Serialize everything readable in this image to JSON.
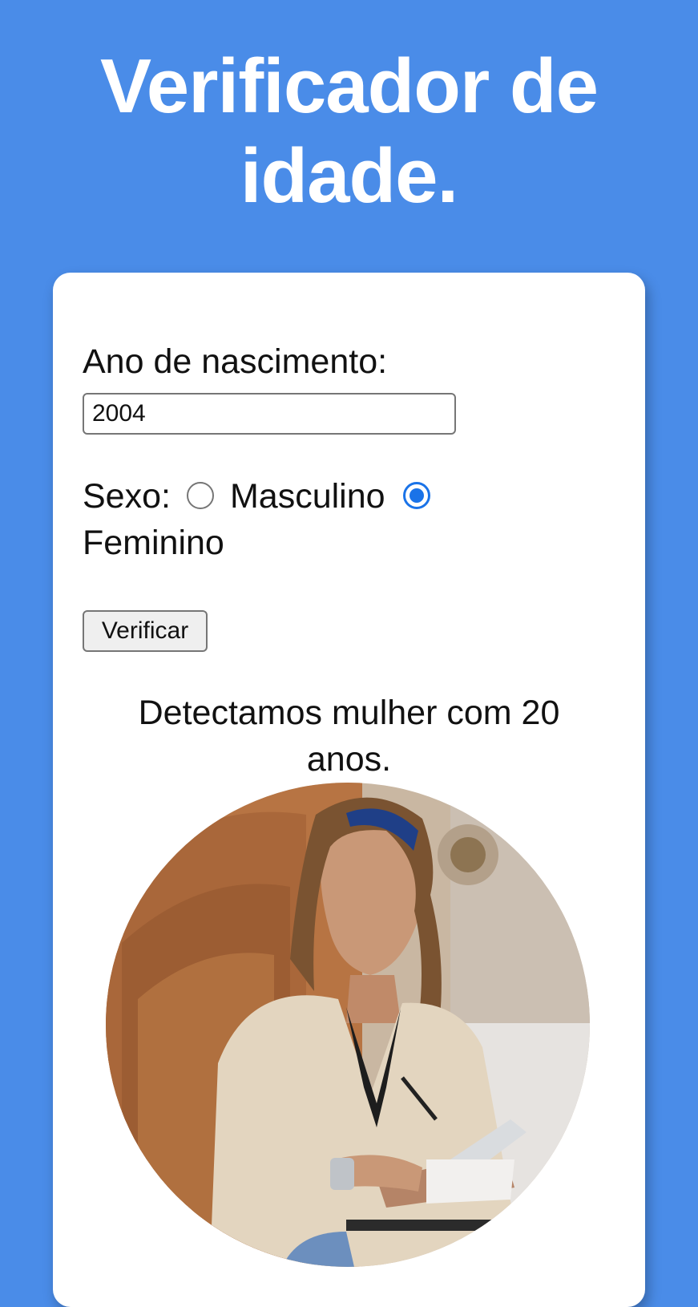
{
  "header": {
    "title": "Verificador de idade."
  },
  "form": {
    "year_label": "Ano de nascimento:",
    "year_value": "2004",
    "sex_label": "Sexo:",
    "options": [
      {
        "label": "Masculino",
        "checked": false
      },
      {
        "label": "Feminino",
        "checked": true
      }
    ],
    "button_label": "Verificar"
  },
  "result": {
    "text": "Detectamos mulher com 20 anos."
  },
  "colors": {
    "background": "#4a8ce8",
    "card": "#ffffff",
    "radio_accent": "#1a73e8"
  }
}
